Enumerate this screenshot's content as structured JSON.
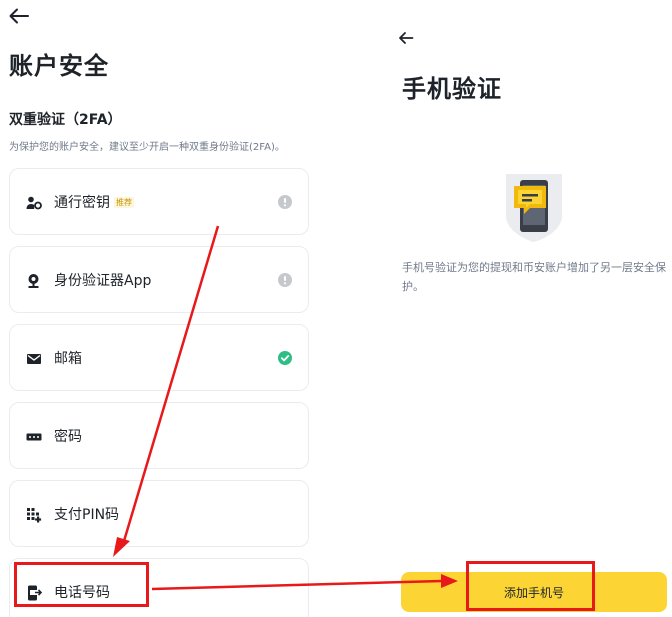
{
  "left": {
    "title": "账户安全",
    "section_title": "双重验证（2FA）",
    "section_desc": "为保护您的账户安全，建议至少开启一种双重身份验证(2FA)。",
    "options": [
      {
        "label": "通行密钥",
        "badge": "推荐",
        "icon": "passkey-icon",
        "status": "warning"
      },
      {
        "label": "身份验证器App",
        "icon": "authenticator-icon",
        "status": "warning"
      },
      {
        "label": "邮箱",
        "icon": "mail-icon",
        "status": "enabled"
      },
      {
        "label": "密码",
        "icon": "password-icon",
        "status": "none"
      },
      {
        "label": "支付PIN码",
        "icon": "pin-grid-icon",
        "status": "none"
      },
      {
        "label": "电话号码",
        "icon": "phone-icon",
        "status": "none"
      }
    ]
  },
  "right": {
    "title": "手机验证",
    "desc": "手机号验证为您的提现和币安账户增加了另一层安全保护。",
    "button_label": "添加手机号"
  },
  "colors": {
    "accent": "#fcd535",
    "success": "#2ebd85",
    "muted": "#c5c8cc",
    "annotation": "#e8191b"
  }
}
